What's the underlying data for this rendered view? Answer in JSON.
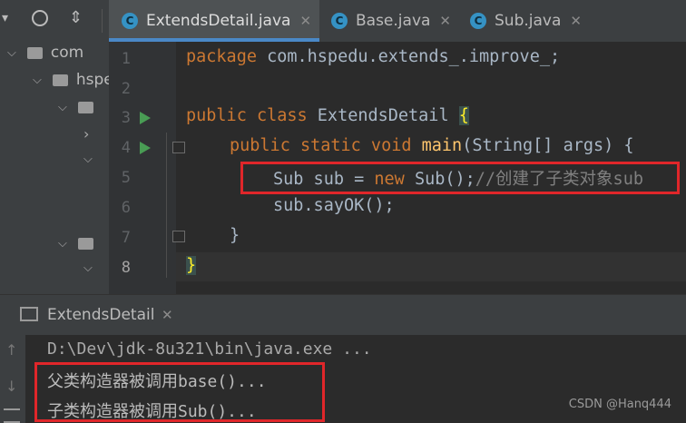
{
  "tabs": [
    {
      "icon": "C",
      "label": "ExtendsDetail.java",
      "close": "✕"
    },
    {
      "icon": "C",
      "label": "Base.java",
      "close": "✕"
    },
    {
      "icon": "C",
      "label": "Sub.java",
      "close": "✕"
    }
  ],
  "project_tree": {
    "root_label": "com",
    "child_label": "hspedu"
  },
  "line_numbers": [
    "1",
    "2",
    "3",
    "4",
    "5",
    "6",
    "7",
    "8"
  ],
  "code": {
    "l1_kw": "package",
    "l1_rest": " com.hspedu.extends_.improve_;",
    "l3_kw": "public class",
    "l3_name": " ExtendsDetail ",
    "l3_brace": "{",
    "l4_kw": "public static void",
    "l4_fn": "main",
    "l4_rest": "(String[] args) {",
    "l5_pre": "Sub sub = ",
    "l5_kw": "new",
    "l5_mid": " Sub();",
    "l5_comment": "//创建了子类对象sub",
    "l6": "sub.sayOK();",
    "l7": "}",
    "l8": "}"
  },
  "run_panel": {
    "title": "ExtendsDetail",
    "command": "D:\\Dev\\jdk-8u321\\bin\\java.exe ...",
    "output": [
      "父类构造器被调用base()...",
      "子类构造器被调用Sub()..."
    ]
  },
  "watermark": "CSDN @Hanq444",
  "colors": {
    "keyword": "#cc7832",
    "function": "#ffc66d",
    "comment": "#808080",
    "highlight_box": "#e0262a",
    "tab_underline": "#4a88c7"
  }
}
